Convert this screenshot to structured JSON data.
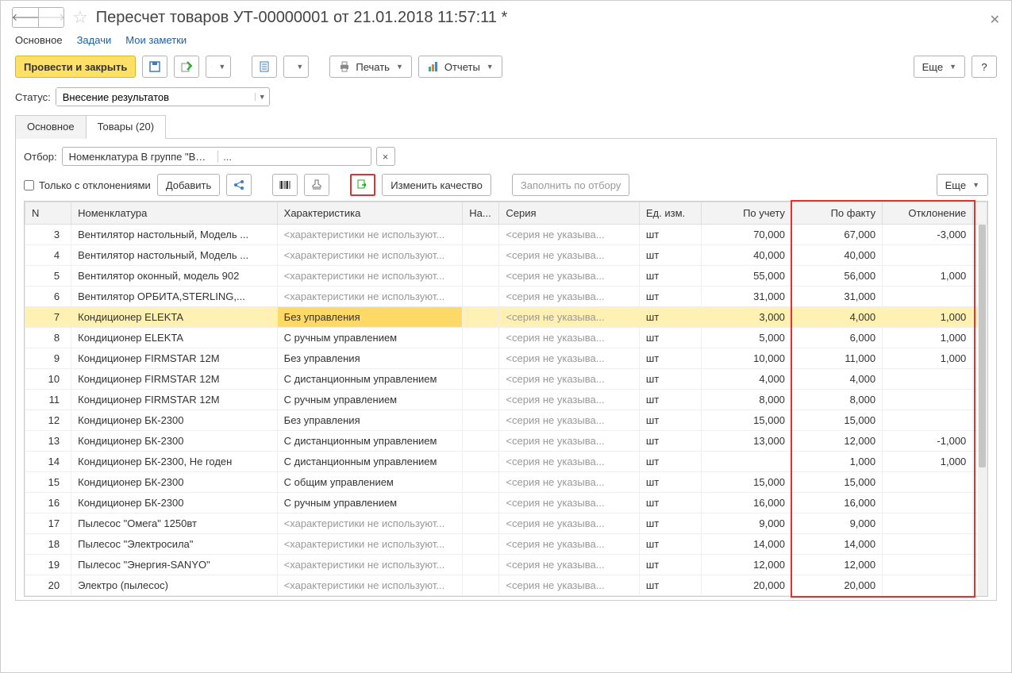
{
  "title": "Пересчет товаров УТ-00000001 от 21.01.2018 11:57:11 *",
  "links": {
    "main": "Основное",
    "tasks": "Задачи",
    "notes": "Мои заметки"
  },
  "toolbar": {
    "post_close": "Провести и закрыть",
    "print": "Печать",
    "reports": "Отчеты",
    "more": "Еще",
    "help": "?"
  },
  "status": {
    "label": "Статус:",
    "value": "Внесение результатов"
  },
  "tabs": {
    "main": "Основное",
    "goods": "Товары (20)"
  },
  "filter": {
    "label": "Отбор:",
    "value": "Номенклатура В группе \"Вентиляторы, пылесосы, кондицио",
    "deviations_only": "Только с отклонениями",
    "add": "Добавить",
    "change_quality": "Изменить качество",
    "fill_by_filter": "Заполнить по отбору",
    "more": "Еще"
  },
  "columns": {
    "n": "N",
    "nom": "Номенклатура",
    "char": "Характеристика",
    "na": "На...",
    "ser": "Серия",
    "unit": "Ед. изм.",
    "acc": "По учету",
    "fact": "По факту",
    "dev": "Отклонение"
  },
  "placeholders": {
    "char_not_used": "<характеристики не используют...",
    "series_not_set": "<серия не указыва..."
  },
  "unit_default": "шт",
  "rows": [
    {
      "n": 3,
      "nom": "Вентилятор настольный, Модель ...",
      "char": null,
      "acc": "70,000",
      "fact": "67,000",
      "dev": "-3,000"
    },
    {
      "n": 4,
      "nom": "Вентилятор настольный, Модель ...",
      "char": null,
      "acc": "40,000",
      "fact": "40,000",
      "dev": ""
    },
    {
      "n": 5,
      "nom": "Вентилятор оконный, модель 902",
      "char": null,
      "acc": "55,000",
      "fact": "56,000",
      "dev": "1,000"
    },
    {
      "n": 6,
      "nom": "Вентилятор ОРБИТА,STERLING,...",
      "char": null,
      "acc": "31,000",
      "fact": "31,000",
      "dev": ""
    },
    {
      "n": 7,
      "nom": "Кондиционер ELEKTA",
      "char": "Без управления",
      "acc": "3,000",
      "fact": "4,000",
      "dev": "1,000",
      "selected": true
    },
    {
      "n": 8,
      "nom": "Кондиционер ELEKTA",
      "char": "С ручным управлением",
      "acc": "5,000",
      "fact": "6,000",
      "dev": "1,000"
    },
    {
      "n": 9,
      "nom": "Кондиционер FIRMSTAR 12M",
      "char": "Без управления",
      "acc": "10,000",
      "fact": "11,000",
      "dev": "1,000"
    },
    {
      "n": 10,
      "nom": "Кондиционер FIRMSTAR 12M",
      "char": "С дистанционным управлением",
      "acc": "4,000",
      "fact": "4,000",
      "dev": ""
    },
    {
      "n": 11,
      "nom": "Кондиционер FIRMSTAR 12M",
      "char": "С ручным управлением",
      "acc": "8,000",
      "fact": "8,000",
      "dev": ""
    },
    {
      "n": 12,
      "nom": "Кондиционер БК-2300",
      "char": "Без управления",
      "acc": "15,000",
      "fact": "15,000",
      "dev": ""
    },
    {
      "n": 13,
      "nom": "Кондиционер БК-2300",
      "char": "С дистанционным управлением",
      "acc": "13,000",
      "fact": "12,000",
      "dev": "-1,000"
    },
    {
      "n": 14,
      "nom": "Кондиционер БК-2300, Не годен",
      "char": "С дистанционным управлением",
      "acc": "",
      "fact": "1,000",
      "dev": "1,000"
    },
    {
      "n": 15,
      "nom": "Кондиционер БК-2300",
      "char": "С общим управлением",
      "acc": "15,000",
      "fact": "15,000",
      "dev": ""
    },
    {
      "n": 16,
      "nom": "Кондиционер БК-2300",
      "char": "С ручным управлением",
      "acc": "16,000",
      "fact": "16,000",
      "dev": ""
    },
    {
      "n": 17,
      "nom": "Пылесос \"Омега\" 1250вт",
      "char": null,
      "acc": "9,000",
      "fact": "9,000",
      "dev": ""
    },
    {
      "n": 18,
      "nom": "Пылесос \"Электросила\"",
      "char": null,
      "acc": "14,000",
      "fact": "14,000",
      "dev": ""
    },
    {
      "n": 19,
      "nom": "Пылесос \"Энергия-SANYO\"",
      "char": null,
      "acc": "12,000",
      "fact": "12,000",
      "dev": ""
    },
    {
      "n": 20,
      "nom": "Электро (пылесос)",
      "char": null,
      "acc": "20,000",
      "fact": "20,000",
      "dev": ""
    }
  ]
}
